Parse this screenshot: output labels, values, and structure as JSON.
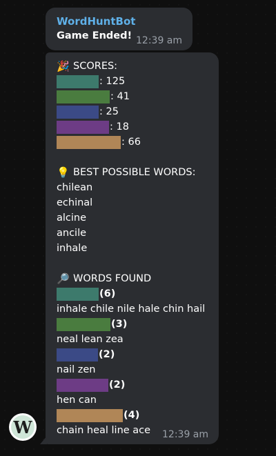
{
  "message1": {
    "sender": "WordHuntBot",
    "text": "Game Ended!",
    "time": "12:39 am"
  },
  "message2": {
    "scores_header": {
      "emoji": "🎉",
      "label": "SCORES:"
    },
    "scores": [
      {
        "color": "#3d7a6c",
        "score": ": 125"
      },
      {
        "color": "#4a7c3f",
        "score": ": 41"
      },
      {
        "color": "#3b4a86",
        "score": ": 25"
      },
      {
        "color": "#6d3c85",
        "score": ": 18"
      },
      {
        "color": "#b08657",
        "score": ": 66"
      }
    ],
    "best_header": {
      "emoji": "💡",
      "label": "BEST POSSIBLE WORDS:"
    },
    "best_words": [
      "chilean",
      "echinal",
      "alcine",
      "ancile",
      "inhale"
    ],
    "found_header": {
      "emoji": "🔎",
      "label": "WORDS FOUND"
    },
    "found": [
      {
        "color": "#3d7a6c",
        "count": "(6)",
        "words": "inhale chile nile hale chin hail"
      },
      {
        "color": "#4a7c3f",
        "count": "(3)",
        "words": "neal lean zea"
      },
      {
        "color": "#3b4a86",
        "count": "(2)",
        "words": "nail zen"
      },
      {
        "color": "#6d3c85",
        "count": "(2)",
        "words": "hen can"
      },
      {
        "color": "#b08657",
        "count": "(4)",
        "words": "chain heal line ace"
      }
    ],
    "time": "12:39 am"
  },
  "avatar_letter": "W"
}
